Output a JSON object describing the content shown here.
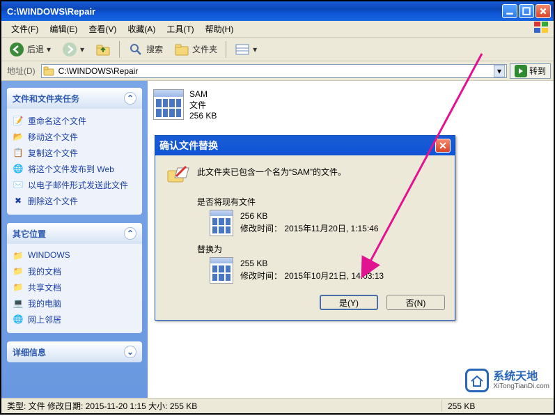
{
  "window": {
    "title": "C:\\WINDOWS\\Repair"
  },
  "menu": {
    "file": "文件(F)",
    "edit": "编辑(E)",
    "view": "查看(V)",
    "favorites": "收藏(A)",
    "tools": "工具(T)",
    "help": "帮助(H)"
  },
  "toolbar": {
    "back": "后退",
    "search": "搜索",
    "folders": "文件夹"
  },
  "address": {
    "label": "地址(D)",
    "value": "C:\\WINDOWS\\Repair",
    "go": "转到"
  },
  "sidebar": {
    "tasks": {
      "header": "文件和文件夹任务",
      "items": [
        "重命名这个文件",
        "移动这个文件",
        "复制这个文件",
        "将这个文件发布到 Web",
        "以电子邮件形式发送此文件",
        "删除这个文件"
      ]
    },
    "places": {
      "header": "其它位置",
      "items": [
        "WINDOWS",
        "我的文档",
        "共享文档",
        "我的电脑",
        "网上邻居"
      ]
    },
    "details": {
      "header": "详细信息"
    }
  },
  "file": {
    "name": "SAM",
    "type": "文件",
    "size": "256 KB"
  },
  "dialog": {
    "title": "确认文件替换",
    "message": "此文件夹已包含一个名为“SAM”的文件。",
    "existing_label": "是否将现有文件",
    "existing_size": "256 KB",
    "existing_mod": "修改时间： 2015年11月20日,  1:15:46",
    "replace_label": "替换为",
    "replace_size": "255 KB",
    "replace_mod": "修改时间： 2015年10月21日,  14:03:13",
    "yes": "是(Y)",
    "no": "否(N)"
  },
  "status": {
    "left": "类型: 文件 修改日期: 2015-11-20 1:15 大小: 255 KB",
    "right": "255 KB"
  },
  "watermark": {
    "cn": "系统天地",
    "en": "XiTongTianDi.com"
  }
}
